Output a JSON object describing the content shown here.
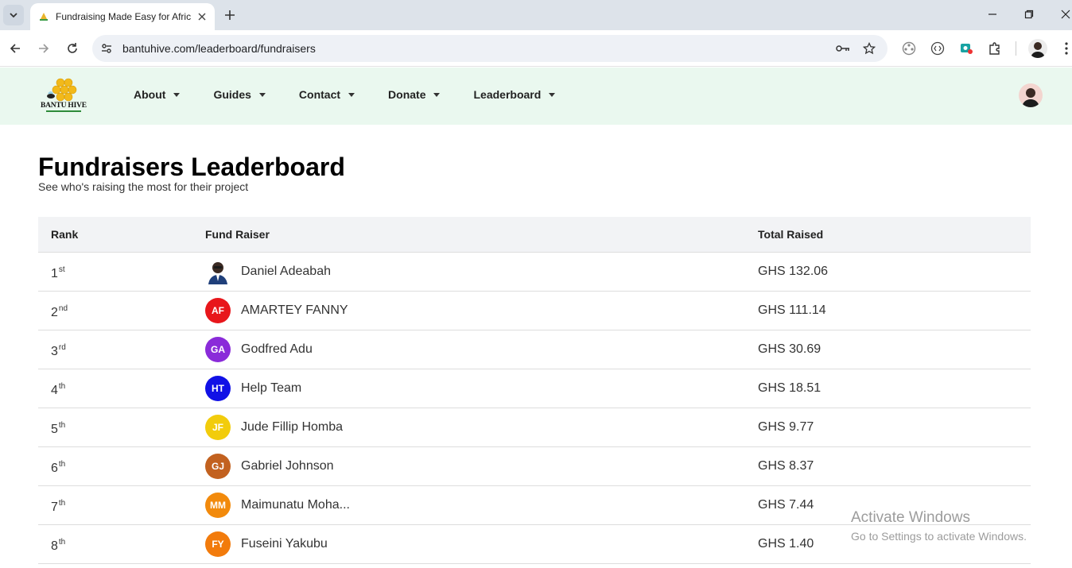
{
  "browser": {
    "tab_title": "Fundraising Made Easy for Afric",
    "url": "bantuhive.com/leaderboard/fundraisers"
  },
  "site": {
    "logo_text": "BANTU HIVE",
    "nav": [
      {
        "label": "About"
      },
      {
        "label": "Guides"
      },
      {
        "label": "Contact"
      },
      {
        "label": "Donate"
      },
      {
        "label": "Leaderboard"
      }
    ]
  },
  "page": {
    "title": "Fundraisers Leaderboard",
    "subtitle": "See who's raising the most for their project"
  },
  "table": {
    "headers": {
      "rank": "Rank",
      "fund_raiser": "Fund Raiser",
      "total_raised": "Total Raised"
    },
    "rows": [
      {
        "rank": "1",
        "suffix": "st",
        "initials": "",
        "name": "Daniel Adeabah",
        "total": "GHS 132.06",
        "color": "#ffffff",
        "photo": true
      },
      {
        "rank": "2",
        "suffix": "nd",
        "initials": "AF",
        "name": "AMARTEY FANNY",
        "total": "GHS 111.14",
        "color": "#e8161b"
      },
      {
        "rank": "3",
        "suffix": "rd",
        "initials": "GA",
        "name": "Godfred Adu",
        "total": "GHS 30.69",
        "color": "#8a2bd9"
      },
      {
        "rank": "4",
        "suffix": "th",
        "initials": "HT",
        "name": "Help Team",
        "total": "GHS 18.51",
        "color": "#1111e6"
      },
      {
        "rank": "5",
        "suffix": "th",
        "initials": "JF",
        "name": "Jude Fillip Homba",
        "total": "GHS 9.77",
        "color": "#f2cc0c"
      },
      {
        "rank": "6",
        "suffix": "th",
        "initials": "GJ",
        "name": "Gabriel Johnson",
        "total": "GHS 8.37",
        "color": "#c2611f"
      },
      {
        "rank": "7",
        "suffix": "th",
        "initials": "MM",
        "name": "Maimunatu Moha...",
        "total": "GHS 7.44",
        "color": "#f28a0c"
      },
      {
        "rank": "8",
        "suffix": "th",
        "initials": "FY",
        "name": "Fuseini Yakubu",
        "total": "GHS 1.40",
        "color": "#f27b0c"
      }
    ]
  },
  "watermark": {
    "line1": "Activate Windows",
    "line2": "Go to Settings to activate Windows."
  }
}
